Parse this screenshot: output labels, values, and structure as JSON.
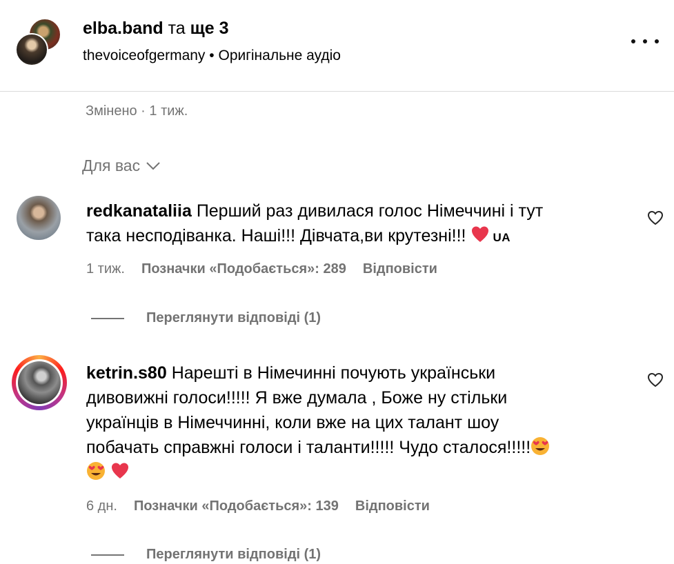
{
  "header": {
    "username": "elba.band",
    "joiner": "та",
    "others": "ще 3",
    "audio_account": "thevoiceofgermany",
    "separator": "•",
    "audio_label": "Оригінальне аудіо"
  },
  "edited_line": "Змінено · 1 тиж.",
  "filter_label": "Для вас",
  "comments": [
    {
      "username": "redkanataliia",
      "line1": "Перший раз дивилася голос Німеччині і тут",
      "line2": "така несподіванка. Наші!!! Дівчата,ви крутезні!!!",
      "flag_text": "UA",
      "time": "1 тиж.",
      "likes": "Позначки «Подобається»: 289",
      "reply": "Відповісти",
      "view_replies": "Переглянути відповіді (1)"
    },
    {
      "username": "ketrin.s80",
      "line1": "Нарешті в Німечинні почують українськи",
      "line2": "дивовижні голоси!!!!! Я вже думала , Боже ну стільки",
      "line3": "українців в Німеччинні, коли вже на цих талант шоу",
      "line4": "побачать справжні голоси і таланти!!!!! Чудо сталося!!!!!",
      "time": "6 дн.",
      "likes": "Позначки «Подобається»: 139",
      "reply": "Відповісти",
      "view_replies": "Переглянути відповіді (1)"
    }
  ],
  "icons": [
    "more-icon",
    "chevron-down-icon",
    "heart-outline-icon",
    "red-heart-emoji",
    "heart-eyes-emoji"
  ],
  "colors": {
    "muted": "#737373",
    "heart_red": "#e8364d",
    "story_ring_start": "#fcaf45",
    "story_ring_end": "#c13584"
  }
}
